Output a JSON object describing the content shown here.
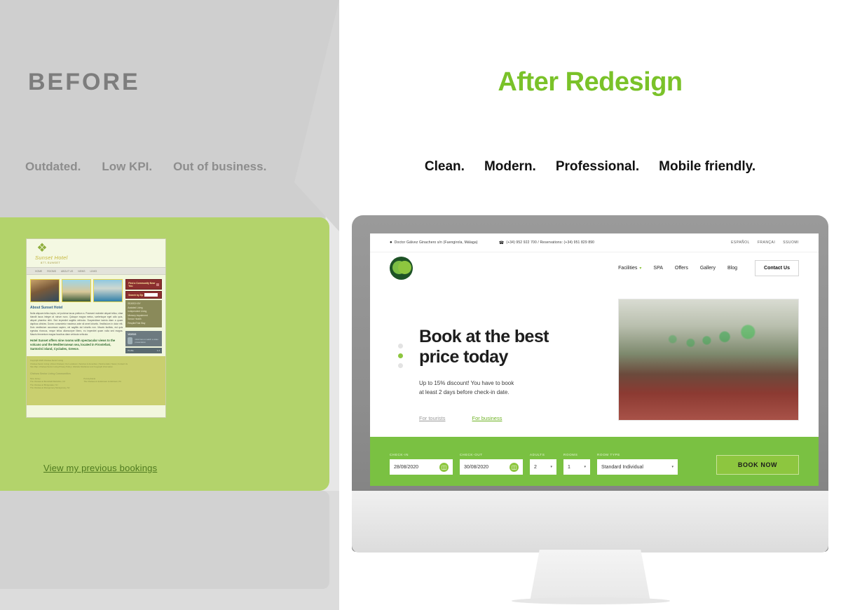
{
  "before": {
    "title": "BEFORE",
    "tags": [
      "Outdated.",
      "Low KPI.",
      "Out of business."
    ],
    "link": "View my previous bookings",
    "old_site": {
      "brand": "Sunset Hotel",
      "brand_sub": "877-SUNSET",
      "nav": [
        "HOME",
        "ROOMS",
        "ABOUT US",
        "NEWS",
        "LINKS"
      ],
      "article_heading": "About Sunset Hotel",
      "article_body": "Nulla aliquam tellus turpis, vel pulvinar lacus pretium a. Praesent molestie aliquet tellus, vitae blandit lacus integer at rutrum nunc. Quisque magna metus, scelerisque eget odio quis, aliquet pharetra nibh. Sed imperdiet sagittis vehicula. Suspendisse lacinia diam a quam dapibus ultricies. Donec consectetur maximus ante sit amet lobortis. Vestibulum in dolor elit. Duis vestibulum accumsan sapien, vel sagittis dui lobortis non. Mauris facilisis, est quis egestas rhoncus, neque tellus ullamcorper libero, eu imperdiet quam nulla sed magna. Mauris fermentum magna faucibus diam vehicula vehicula.",
      "article_highlight": "Hotel Sunset offers nine rooms with spectacular views to the volcano and the Mediterranean sea, located in Firostefani, Santorini island, Cyclades, Greece.",
      "sidebar": {
        "find_box": "Find a Community Near You",
        "search_label": "Search by Zip",
        "list_title": "SEARCH BY",
        "list_items": [
          "Assisted Living",
          "Independent Living",
          "Memory Impairment",
          "Senior Health",
          "Respite/Trial Stay"
        ],
        "video_title": "VIDEOS",
        "video_text": "Click here to watch a video presentation",
        "video_btn": "Profile",
        "video_pages": "1 2"
      },
      "footer": {
        "copyright": "Copyright 2020 Chelsea Senior Living",
        "links": [
          "Chelsea Senior Living",
          "About Chelsea",
          "Our Locations",
          "Services & Amenities",
          "Testimonials",
          "News",
          "Contact Us",
          "Site Map",
          "Chelsea Senior Living Privacy Policy",
          "Website Disclaimer and Copyright Information"
        ],
        "col_title": "Chelsea Senior Living Communities",
        "col1_head": "New Jersey",
        "col1": [
          "The Chelsea at Brookfield Berkshire, NJ",
          "The Chelsea at Bridgewater, NJ",
          "The Chelsea at Montgomery Montgomery, NJ"
        ],
        "col2_head": "Pennsylvania",
        "col2": [
          "The Chelsea at Jenkintown Jenkintown, PA"
        ]
      }
    }
  },
  "after": {
    "title": "After Redesign",
    "tags": [
      "Clean.",
      "Modern.",
      "Professional.",
      "Mobile friendly."
    ],
    "site": {
      "topbar": {
        "address": "Doctor Gálvez Ginachero s/n (Fuengirola, Málaga)",
        "phone": "(+34) 952 922 700  /  Reservations: (+34) 951 829 890",
        "languages": [
          "ESPAÑOL",
          "FRANÇAI",
          "SSUOMI"
        ]
      },
      "nav": {
        "items": [
          "Facilities",
          "SPA",
          "Offers",
          "Gallery",
          "Blog"
        ],
        "cta": "Contact Us"
      },
      "hero": {
        "heading_line1": "Book at the best",
        "heading_line2": "price today",
        "paragraph_line1": "Up to 15% discount! You have to book",
        "paragraph_line2": "at least 2 days before check-in date.",
        "link_tourists": "For tourists",
        "link_business": "For business",
        "slide_count": 3,
        "active_slide": 2
      },
      "booking": {
        "checkin_label": "CHECK-IN",
        "checkin_value": "28/08/2020",
        "checkout_label": "CHECK-OUT",
        "checkout_value": "30/08/2020",
        "adults_label": "ADULTS",
        "adults_value": "2",
        "rooms_label": "ROOMS",
        "rooms_value": "1",
        "roomtype_label": "ROOM TYPE",
        "roomtype_value": "Standard Individual",
        "button": "BOOK NOW"
      }
    }
  },
  "colors": {
    "accent_green": "#7ac229",
    "booking_bar": "#7ac142",
    "before_gray": "#cfcfcf",
    "before_text": "#7d7d7d",
    "old_card_green": "#b3d36b"
  }
}
